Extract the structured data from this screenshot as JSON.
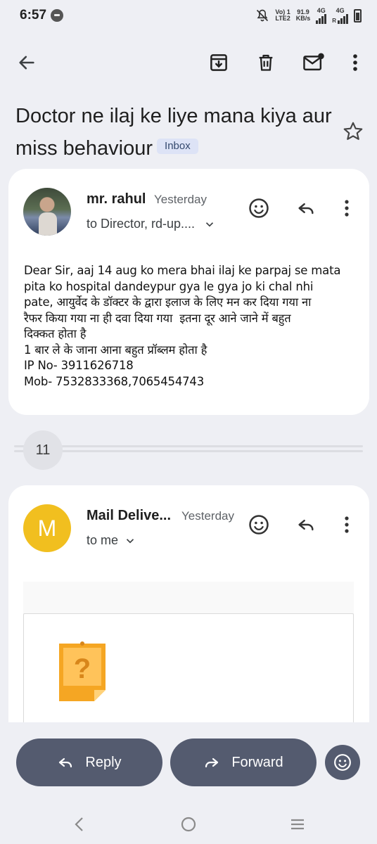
{
  "status_bar": {
    "time": "6:57",
    "net_label_top": "Vo) 1",
    "net_label_bottom": "LTE2",
    "speed_top": "91.9",
    "speed_bottom": "KB/s",
    "sig1_label": "4G",
    "sig2_label": "4G",
    "sig2_sub": "R"
  },
  "toolbar": {
    "back_icon": "arrow-left-icon",
    "archive_icon": "archive-icon",
    "delete_icon": "trash-icon",
    "mark_unread_icon": "mail-unread-icon",
    "more_icon": "more-vert-icon"
  },
  "subject": {
    "text": "Doctor ne ilaj ke liye mana kiya aur miss behaviour",
    "label": "Inbox",
    "star_icon": "star-outline-icon"
  },
  "message1": {
    "sender": "mr. rahul",
    "when": "Yesterday",
    "recipients": "to Director, rd-up....",
    "body_lines": [
      "Dear Sir, aaj 14 aug ko mera bhai ilaj ke parpaj se mata",
      "pita ko hospital dandeypur gya le gya jo ki chal nhi",
      "pate, आयुर्वेद के डॉक्टर के द्वारा इलाज के लिए मन कर दिया गया ना",
      "रैफर किया गया ना ही दवा दिया गया  इतना दूर आने जाने में बहुत",
      "दिक्कत होता है",
      "1 बार ले के जाना आना बहुत प्रॉब्लम होता है",
      "IP No- 3911626718",
      "Mob- 7532833368,7065454743"
    ]
  },
  "collapsed": {
    "count": "11"
  },
  "message2": {
    "avatar_letter": "M",
    "sender": "Mail Delive...",
    "when": "Yesterday",
    "recipients": "to me"
  },
  "actions": {
    "reply_label": "Reply",
    "forward_label": "Forward"
  },
  "colors": {
    "background": "#eeeff4",
    "card": "#ffffff",
    "pill": "#545b6f",
    "chip_bg": "#dde3f6",
    "avatar_m": "#f1bf1f",
    "attachment_icon": "#f5a623"
  }
}
